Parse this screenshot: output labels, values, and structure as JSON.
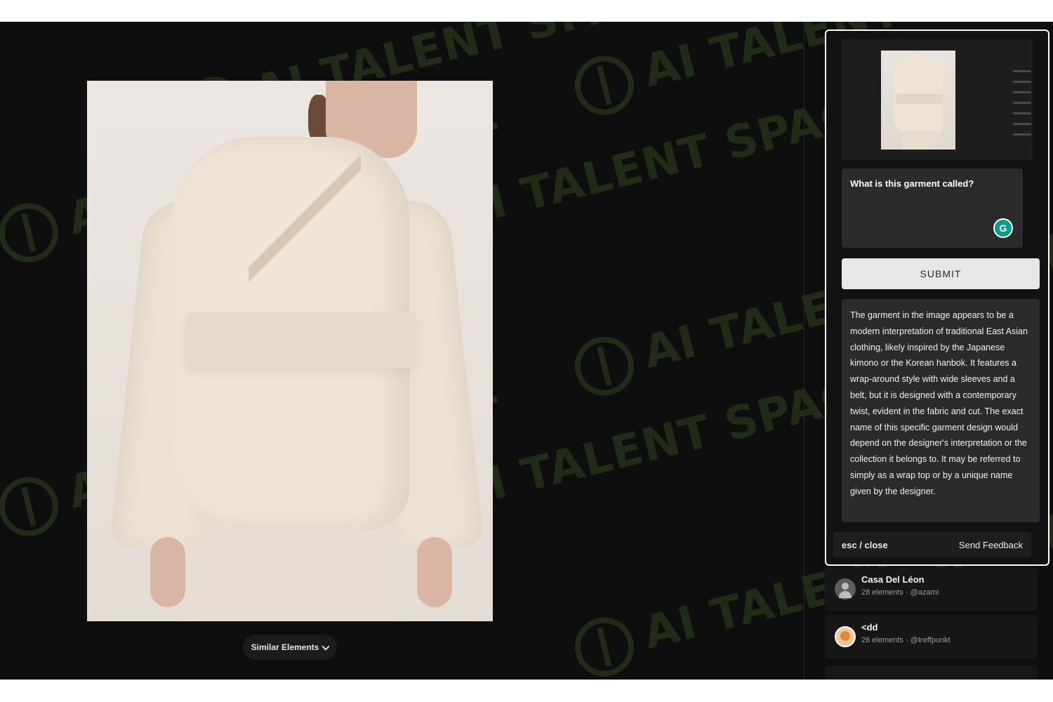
{
  "watermark_text": "AI TALENT SPACE",
  "main_image": {
    "icon": "garment-photo"
  },
  "similar_button": {
    "label": "Similar Elements",
    "icon": "chevron-down-icon"
  },
  "panel": {
    "question": "What is this garment called?",
    "grammarly_icon_glyph": "G",
    "submit_label": "SUBMIT",
    "answer": "The garment in the image appears to be a modern interpretation of traditional East Asian clothing, likely inspired by the Japanese kimono or the Korean hanbok. It features a wrap-around style with wide sleeves and a belt, but it is designed with a contemporary twist, evident in the fabric and cut. The exact name of this specific garment design would depend on the designer's interpretation or the collection it belongs to. It may be referred to simply as a wrap top or by a unique name given by the designer.",
    "close_label": "esc / close",
    "feedback_label": "Send Feedback"
  },
  "collections": [
    {
      "name": "Casa Del Léon",
      "meta": "28 elements · @azami"
    },
    {
      "name": "<dd",
      "meta": "26 elements · @treffpunkt"
    }
  ],
  "colors": {
    "background": "#0e0e0e",
    "panel_border": "#ffffff",
    "input_bg": "#2b2b2b",
    "accent_grammarly": "#0a9d8a"
  }
}
